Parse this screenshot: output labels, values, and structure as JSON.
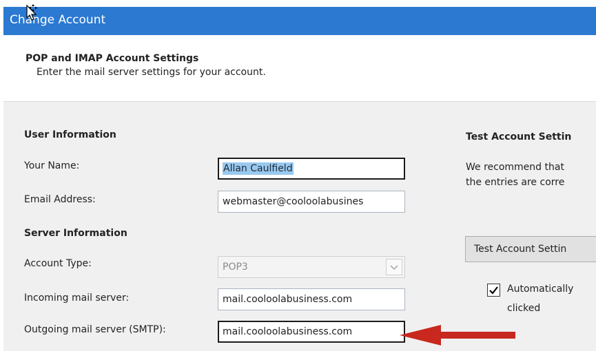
{
  "window": {
    "title": "Change Account"
  },
  "header": {
    "heading": "POP and IMAP Account Settings",
    "subheading": "Enter the mail server settings for your account."
  },
  "user_info": {
    "section_title": "User Information",
    "name_label": "Your Name:",
    "name_value": "Allan Caulfield",
    "email_label": "Email Address:",
    "email_value": "webmaster@cooloolabusines"
  },
  "server_info": {
    "section_title": "Server Information",
    "account_type_label": "Account Type:",
    "account_type_value": "POP3",
    "incoming_label": "Incoming mail server:",
    "incoming_value": "mail.cooloolabusiness.com",
    "outgoing_label": "Outgoing mail server (SMTP):",
    "outgoing_value": "mail.cooloolabusiness.com"
  },
  "test": {
    "section_title": "Test Account Settin",
    "desc_line1": "We recommend that",
    "desc_line2": "the entries are corre",
    "button_label": "Test Account Settin",
    "auto_check_line1": "Automatically",
    "auto_check_line2": "clicked",
    "auto_check_checked": true
  },
  "colors": {
    "titlebar": "#2b79d1",
    "content_bg": "#f0f0f0",
    "annotation_arrow": "#c8281e"
  },
  "icons": {
    "cursor": "move-cursor-icon",
    "dropdown": "chevron-down-icon",
    "check": "checkmark-icon",
    "arrow": "annotation-arrow-icon"
  }
}
